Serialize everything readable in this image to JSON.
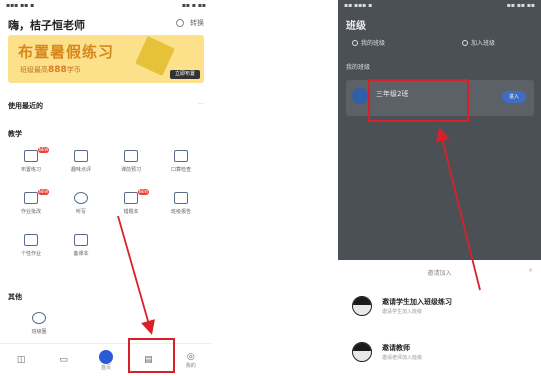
{
  "left": {
    "status": {
      "carrier": "▪▪▪ ▪▪ ▪",
      "time": "▪▪ ▪ ▪▪"
    },
    "greeting": "嗨，桔子恒老师",
    "top_action": "转换",
    "banner": {
      "title": "布置暑假练习",
      "subtitle_prefix": "班级最高",
      "subtitle_value": "888",
      "subtitle_suffix": "学币",
      "badge": "立即布置"
    },
    "recent_section": "使用最近的",
    "recent_more": "···",
    "tools_section": "教学",
    "tools": [
      {
        "label": "布置练习",
        "badge": "NEW",
        "icon": "chat-icon"
      },
      {
        "label": "趣味点评",
        "badge": "",
        "icon": "heart-chat-icon"
      },
      {
        "label": "课前预习",
        "badge": "",
        "icon": "plus-doc-icon"
      },
      {
        "label": "口算检查",
        "badge": "",
        "icon": "doc-icon"
      },
      {
        "label": "作业批改",
        "badge": "NEW",
        "icon": "check-doc-icon"
      },
      {
        "label": "听写",
        "badge": "",
        "icon": "headphone-icon"
      },
      {
        "label": "错题本",
        "badge": "NEW",
        "icon": "frame-icon"
      },
      {
        "label": "班级报告",
        "badge": "",
        "icon": "book-icon"
      },
      {
        "label": "个性作业",
        "badge": "",
        "icon": "image-doc-icon"
      },
      {
        "label": "备课本",
        "badge": "",
        "icon": "bookmark-icon"
      }
    ],
    "other_section": "其他",
    "other_tools": [
      {
        "label": "班级圈",
        "icon": "cloud-icon"
      }
    ],
    "nav": [
      {
        "label": "",
        "icon": "book-icon"
      },
      {
        "label": "",
        "icon": "chat-icon"
      },
      {
        "label": "首页",
        "icon": "home-icon"
      },
      {
        "label": "",
        "icon": "class-icon"
      },
      {
        "label": "我的",
        "icon": "user-icon"
      }
    ]
  },
  "right": {
    "status": {
      "carrier": "▪▪ ▪▪▪ ▪",
      "time": "▪▪ ▪▪ ▪▪"
    },
    "title": "班级",
    "options": [
      "我的班级",
      "加入班级"
    ],
    "section": "我的班级",
    "class_name": "三年级2班",
    "class_button": "进入",
    "sheet_title": "邀请加入",
    "sheet_close": "×",
    "sheet_items": [
      {
        "label": "邀请学生加入班级练习",
        "sub": "邀请学生加入班级"
      },
      {
        "label": "邀请教师",
        "sub": "邀请老师加入班级"
      }
    ]
  },
  "colors": {
    "accent_red": "#d9202a",
    "brand_blue": "#2a5bd7",
    "banner_yellow": "#fde08a",
    "dark_overlay": "#4b5057"
  }
}
